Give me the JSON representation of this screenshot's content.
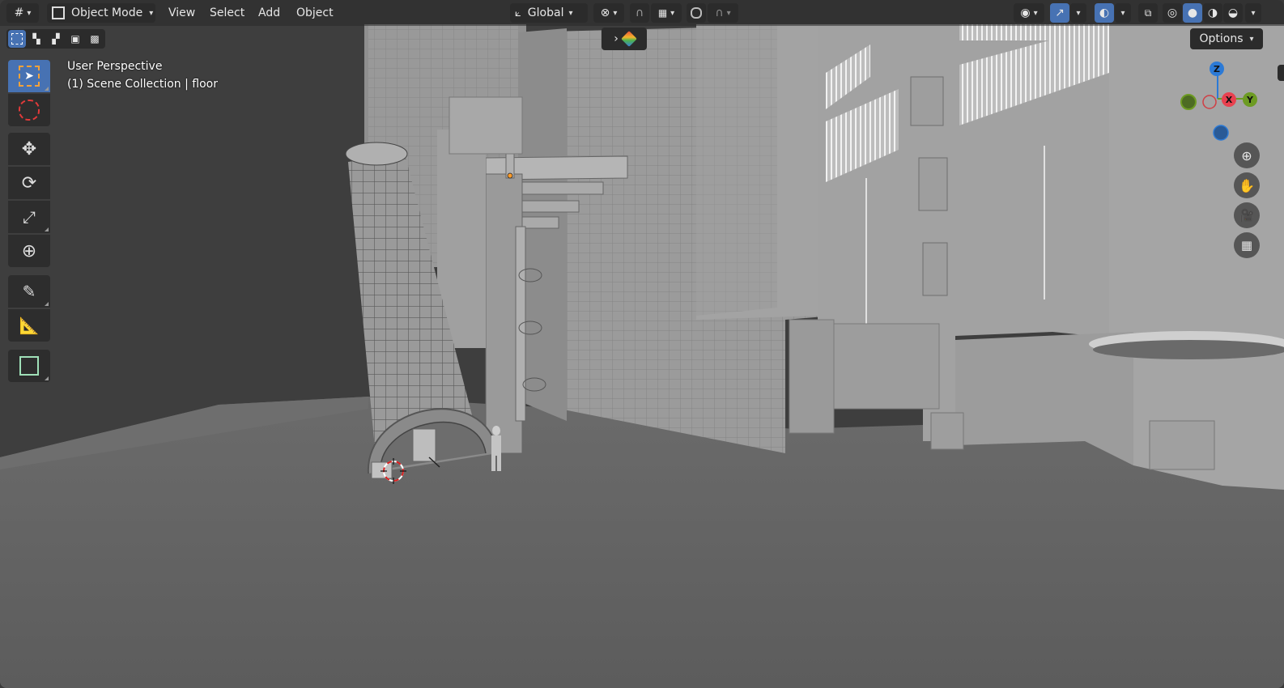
{
  "header": {
    "mode_label": "Object Mode",
    "menus": [
      "View",
      "Select",
      "Add",
      "Object"
    ],
    "transform_orientation": "Global",
    "options_label": "Options"
  },
  "overlay": {
    "view_name": "User Perspective",
    "collection_line": "(1) Scene Collection | floor"
  },
  "gizmo": {
    "z_label": "Z",
    "x_label": "X",
    "y_label": "Y",
    "colors": {
      "x": "#e8414f",
      "y": "#6d9b23",
      "z": "#2c7ad6"
    }
  },
  "toolbar": {
    "tools": [
      "select-box",
      "cursor",
      "move",
      "rotate",
      "scale",
      "transform",
      "annotate",
      "measure",
      "add-cube"
    ],
    "active": "select-box"
  },
  "colors": {
    "accent": "#4772b3",
    "header_bg": "#2b2b2b",
    "floor": "#676767",
    "buildings": "#9a9a9a"
  }
}
